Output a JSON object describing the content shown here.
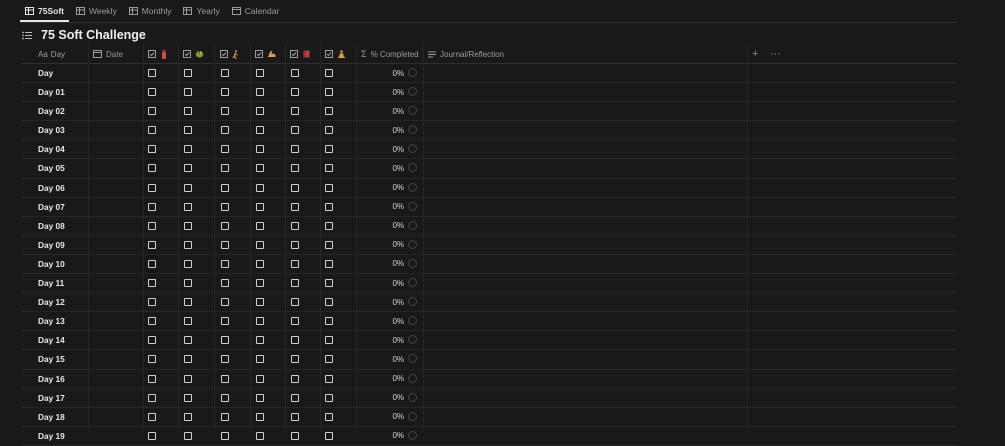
{
  "tabs": [
    {
      "label": "75Soft",
      "active": true
    },
    {
      "label": "Weekly",
      "active": false
    },
    {
      "label": "Monthly",
      "active": false
    },
    {
      "label": "Yearly",
      "active": false
    },
    {
      "label": "Calendar",
      "active": false
    }
  ],
  "page_title": "75 Soft Challenge",
  "columns": {
    "day": {
      "prefix": "Aa",
      "label": "Day"
    },
    "date": {
      "label": "Date"
    },
    "habits": [
      {
        "icon": "water-bottle-icon",
        "color": "#c94f4f"
      },
      {
        "icon": "salad-bowl-icon",
        "color": "#8a9a3a"
      },
      {
        "icon": "running-person-icon",
        "color": "#d08a3a"
      },
      {
        "icon": "flexed-bicep-icon",
        "color": "#d4a24a"
      },
      {
        "icon": "book-icon",
        "color": "#c03a3a"
      },
      {
        "icon": "meditation-person-icon",
        "color": "#d4a24a"
      }
    ],
    "completed": {
      "label": "% Completed"
    },
    "journal": {
      "label": "Journal/Reflection"
    }
  },
  "rows": [
    {
      "day": "Day",
      "pct": "0%"
    },
    {
      "day": "Day 01",
      "pct": "0%"
    },
    {
      "day": "Day 02",
      "pct": "0%"
    },
    {
      "day": "Day 03",
      "pct": "0%"
    },
    {
      "day": "Day 04",
      "pct": "0%"
    },
    {
      "day": "Day 05",
      "pct": "0%"
    },
    {
      "day": "Day 06",
      "pct": "0%"
    },
    {
      "day": "Day 07",
      "pct": "0%"
    },
    {
      "day": "Day 08",
      "pct": "0%"
    },
    {
      "day": "Day 09",
      "pct": "0%"
    },
    {
      "day": "Day 10",
      "pct": "0%"
    },
    {
      "day": "Day 11",
      "pct": "0%"
    },
    {
      "day": "Day 12",
      "pct": "0%"
    },
    {
      "day": "Day 13",
      "pct": "0%"
    },
    {
      "day": "Day 14",
      "pct": "0%"
    },
    {
      "day": "Day 15",
      "pct": "0%"
    },
    {
      "day": "Day 16",
      "pct": "0%"
    },
    {
      "day": "Day 17",
      "pct": "0%"
    },
    {
      "day": "Day 18",
      "pct": "0%"
    },
    {
      "day": "Day 19",
      "pct": "0%"
    }
  ]
}
